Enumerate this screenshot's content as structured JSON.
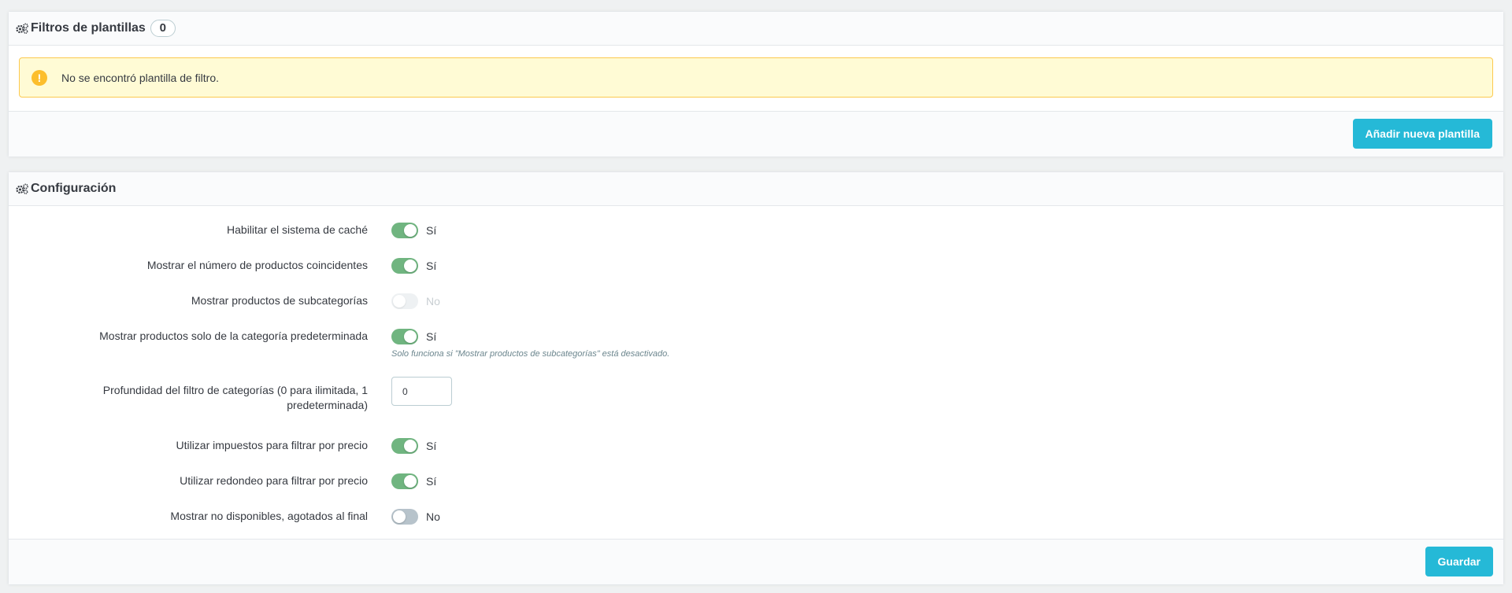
{
  "templates_panel": {
    "title": "Filtros de plantillas",
    "count": "0",
    "alert_text": "No se encontró plantilla de filtro.",
    "alert_icon": "exclamation-circle-icon",
    "add_button": "Añadir nueva plantilla"
  },
  "config_panel": {
    "title": "Configuración",
    "save_button": "Guardar",
    "settings": [
      {
        "label": "Habilitar el sistema de caché",
        "state": "on",
        "value": "Sí"
      },
      {
        "label": "Mostrar el número de productos coincidentes",
        "state": "on",
        "value": "Sí"
      },
      {
        "label": "Mostrar productos de subcategorías",
        "state": "disabled",
        "value": "No"
      },
      {
        "label": "Mostrar productos solo de la categoría predeterminada",
        "state": "on",
        "value": "Sí",
        "help": "Solo funciona si \"Mostrar productos de subcategorías\" está desactivado."
      },
      {
        "label": "Profundidad del filtro de categorías (0 para ilimitada, 1 predeterminada)",
        "input_value": "0"
      },
      {
        "label": "Utilizar impuestos para filtrar por precio",
        "state": "on",
        "value": "Sí"
      },
      {
        "label": "Utilizar redondeo para filtrar por precio",
        "state": "on",
        "value": "Sí"
      },
      {
        "label": "Mostrar no disponibles, agotados al final",
        "state": "off",
        "value": "No"
      }
    ]
  },
  "colors": {
    "accent": "#25b9d7",
    "switch_on": "#70b580",
    "switch_off": "#b7c3cb",
    "alert_bg": "#fffbd5",
    "alert_border": "#fcc94f"
  }
}
